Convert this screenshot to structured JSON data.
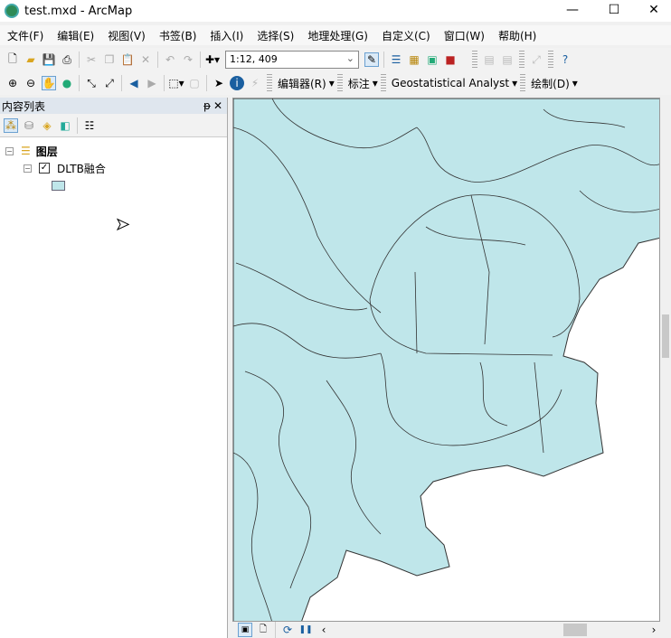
{
  "window": {
    "title": "test.mxd - ArcMap",
    "minimize": "—",
    "maximize": "☐",
    "close": "✕"
  },
  "menu": [
    "文件(F)",
    "编辑(E)",
    "视图(V)",
    "书签(B)",
    "插入(I)",
    "选择(S)",
    "地理处理(G)",
    "自定义(C)",
    "窗口(W)",
    "帮助(H)"
  ],
  "toolbar": {
    "scale": "1:12, 409",
    "editor": "编辑器(R)",
    "label": "标注",
    "geostat": "Geostatistical Analyst",
    "draw": "绘制(D)"
  },
  "toc": {
    "title": "内容列表",
    "pin": "ᵽ",
    "close": "✕",
    "group": "图层",
    "layer": "DLTB融合",
    "layer_checked": true
  },
  "map": {
    "fill": "#bfe6ea",
    "stroke": "#333333"
  }
}
